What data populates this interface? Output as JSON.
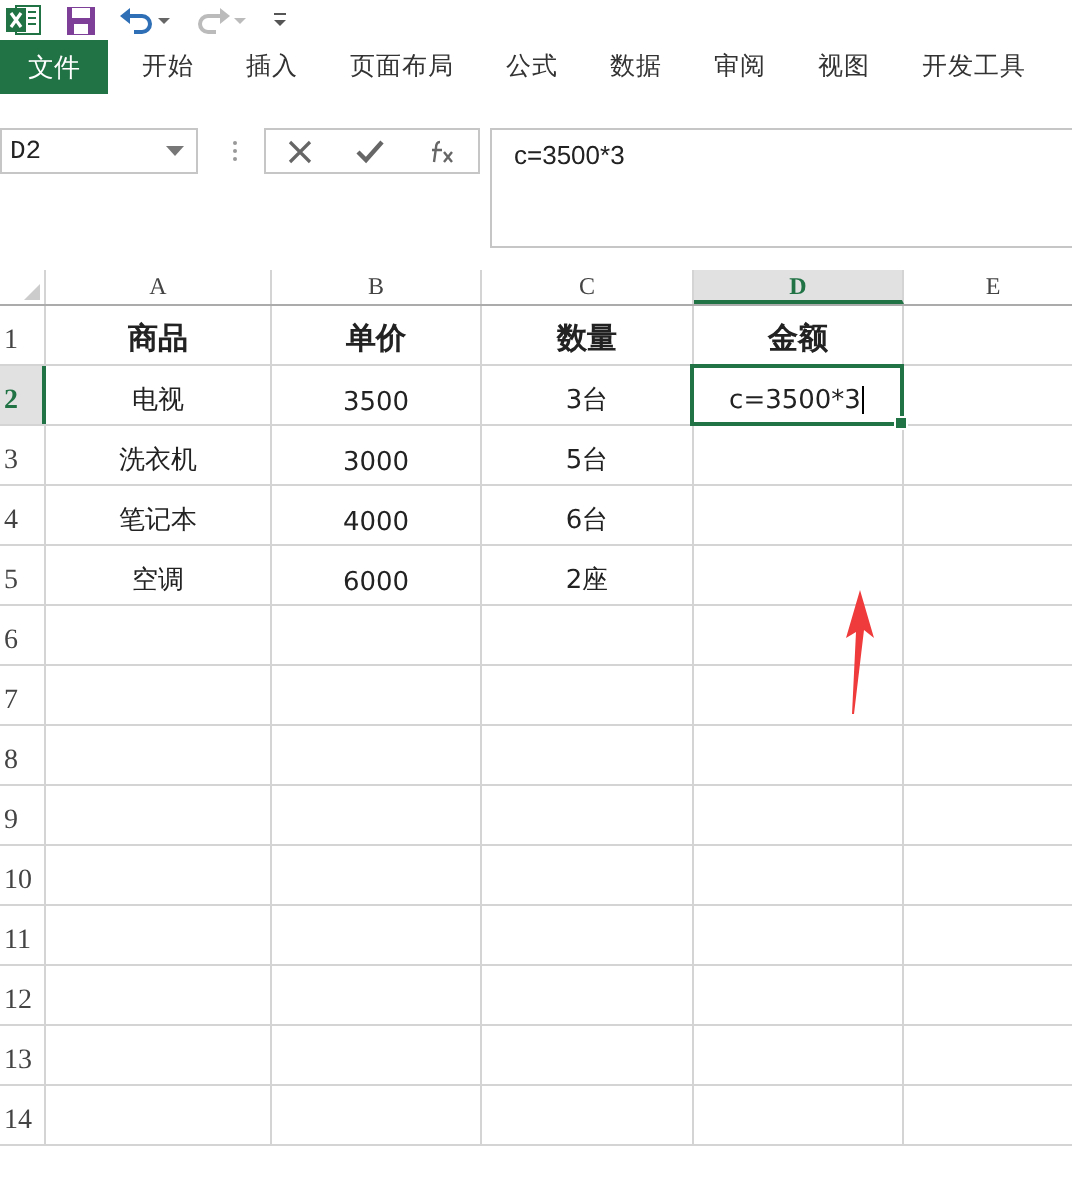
{
  "file_button": {
    "label": "文件"
  },
  "tabs": [
    {
      "label": "开始",
      "selected": false
    },
    {
      "label": "插入",
      "selected": false
    },
    {
      "label": "页面布局",
      "selected": false
    },
    {
      "label": "公式",
      "selected": false
    },
    {
      "label": "数据",
      "selected": false
    },
    {
      "label": "审阅",
      "selected": false
    },
    {
      "label": "视图",
      "selected": false
    },
    {
      "label": "开发工具",
      "selected": false
    }
  ],
  "name_box": {
    "value": "D2"
  },
  "formula_bar": {
    "value": "c=3500*3"
  },
  "columns": [
    {
      "label": "A",
      "selected": false
    },
    {
      "label": "B",
      "selected": false
    },
    {
      "label": "C",
      "selected": false
    },
    {
      "label": "D",
      "selected": true
    },
    {
      "label": "E",
      "selected": false
    }
  ],
  "rows": [
    {
      "label": "1",
      "selected": false,
      "bold": true,
      "cells": [
        {
          "text": "商品",
          "selected": false
        },
        {
          "text": "单价",
          "selected": false
        },
        {
          "text": "数量",
          "selected": false
        },
        {
          "text": "金额",
          "selected": false
        }
      ]
    },
    {
      "label": "2",
      "selected": true,
      "bold": false,
      "cells": [
        {
          "text": "电视",
          "selected": false
        },
        {
          "text": "3500",
          "selected": false
        },
        {
          "text": "3台",
          "selected": false
        },
        {
          "text": "c=3500*3",
          "selected": true,
          "editing": true
        }
      ]
    },
    {
      "label": "3",
      "selected": false,
      "bold": false,
      "cells": [
        {
          "text": "洗衣机",
          "selected": false
        },
        {
          "text": "3000",
          "selected": false
        },
        {
          "text": "5台",
          "selected": false
        }
      ]
    },
    {
      "label": "4",
      "selected": false,
      "bold": false,
      "cells": [
        {
          "text": "笔记本",
          "selected": false
        },
        {
          "text": "4000",
          "selected": false
        },
        {
          "text": "6台",
          "selected": false
        }
      ]
    },
    {
      "label": "5",
      "selected": false,
      "bold": false,
      "cells": [
        {
          "text": "空调",
          "selected": false
        },
        {
          "text": "6000",
          "selected": false
        },
        {
          "text": "2座",
          "selected": false
        }
      ]
    },
    {
      "label": "6",
      "selected": false
    },
    {
      "label": "7",
      "selected": false
    },
    {
      "label": "8",
      "selected": false
    },
    {
      "label": "9",
      "selected": false
    },
    {
      "label": "10",
      "selected": false
    },
    {
      "label": "11",
      "selected": false
    },
    {
      "label": "12",
      "selected": false
    },
    {
      "label": "13",
      "selected": false
    },
    {
      "label": "14",
      "selected": false
    }
  ]
}
